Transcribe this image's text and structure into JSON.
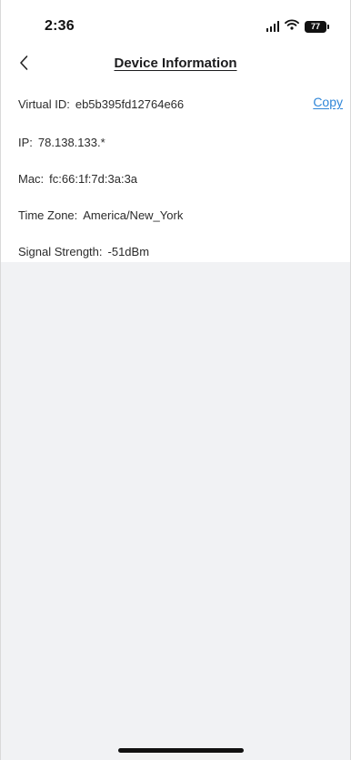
{
  "status_bar": {
    "time": "2:36",
    "battery_level": "77",
    "signal_icon": "cellular-signal-icon",
    "wifi_icon": "wifi-icon",
    "battery_icon": "battery-icon"
  },
  "header": {
    "title": "Device Information",
    "back_icon": "chevron-left-icon"
  },
  "device_info": [
    {
      "label": "Virtual ID:",
      "value": "eb5b395fd12764e66"
    },
    {
      "label": "IP:",
      "value": "78.138.133.*"
    },
    {
      "label": "Mac:",
      "value": "fc:66:1f:7d:3a:3a"
    },
    {
      "label": "Time Zone:",
      "value": "America/New_York"
    },
    {
      "label": "Signal Strength:",
      "value": "-51dBm"
    }
  ],
  "actions": {
    "copy_label": "Copy"
  },
  "colors": {
    "link": "#2f86d8",
    "content_background": "#f1f2f4",
    "text": "#2b2b2b"
  }
}
